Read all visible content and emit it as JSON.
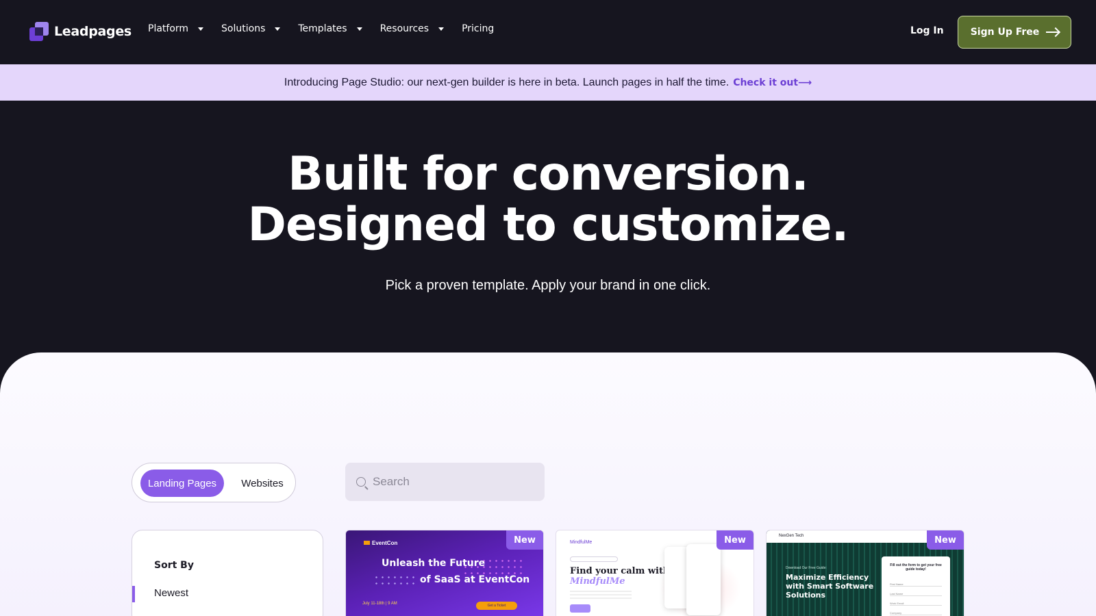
{
  "nav": {
    "brand": "Leadpages",
    "menu": [
      {
        "label": "Platform",
        "dropdown": true
      },
      {
        "label": "Solutions",
        "dropdown": true
      },
      {
        "label": "Templates",
        "dropdown": true
      },
      {
        "label": "Resources",
        "dropdown": true
      },
      {
        "label": "Pricing",
        "dropdown": false
      }
    ],
    "login": "Log In",
    "signup": "Sign Up Free"
  },
  "announcement": {
    "text": "Introducing Page Studio: our next-gen builder is here in beta. Launch pages in half the time.",
    "link": "Check it out⟶"
  },
  "hero": {
    "title_line1": "Built for conversion.",
    "title_line2": "Designed to customize.",
    "subtitle": "Pick a proven template. Apply your brand in one click."
  },
  "filters": {
    "tabs": [
      "Landing Pages",
      "Websites"
    ],
    "active_tab": "Landing Pages",
    "search_placeholder": "Search",
    "sort_title": "Sort By",
    "sort_option": "Newest"
  },
  "templates": [
    {
      "badge": "New",
      "brand": "EventCon",
      "heading1": "Unleash the Future",
      "heading2": "of SaaS at EventCon",
      "date": "July 11-18th | 9 AM",
      "cta": "Get a Ticket"
    },
    {
      "badge": "New",
      "brand": "MindfulMe",
      "heading": "Find your calm with",
      "heading_accent": "MindfulMe"
    },
    {
      "badge": "New",
      "brand": "NexGen Tech",
      "kicker": "Download Our Free Guide:",
      "heading": "Maximize Efficiency with Smart Software Solutions",
      "form_title": "Fill out the form to get your free guide today!",
      "form_fields": [
        "First Name",
        "Last Name",
        "Work Email",
        "Company"
      ]
    }
  ],
  "colors": {
    "background": "#16151f",
    "announce_bg": "#e4d6fb",
    "accent": "#8a5ce8",
    "signup_bg": "#5a6f2e"
  }
}
